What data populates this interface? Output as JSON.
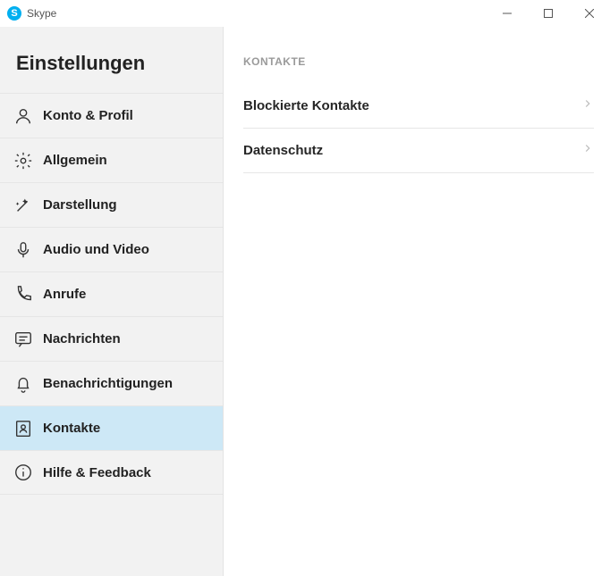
{
  "window": {
    "title": "Skype",
    "logo_letter": "S"
  },
  "sidebar": {
    "heading": "Einstellungen",
    "items": [
      {
        "label": "Konto & Profil"
      },
      {
        "label": "Allgemein"
      },
      {
        "label": "Darstellung"
      },
      {
        "label": "Audio und Video"
      },
      {
        "label": "Anrufe"
      },
      {
        "label": "Nachrichten"
      },
      {
        "label": "Benachrichtigungen"
      },
      {
        "label": "Kontakte"
      },
      {
        "label": "Hilfe & Feedback"
      }
    ]
  },
  "main": {
    "section_title": "KONTAKTE",
    "rows": [
      {
        "label": "Blockierte Kontakte"
      },
      {
        "label": "Datenschutz"
      }
    ]
  }
}
